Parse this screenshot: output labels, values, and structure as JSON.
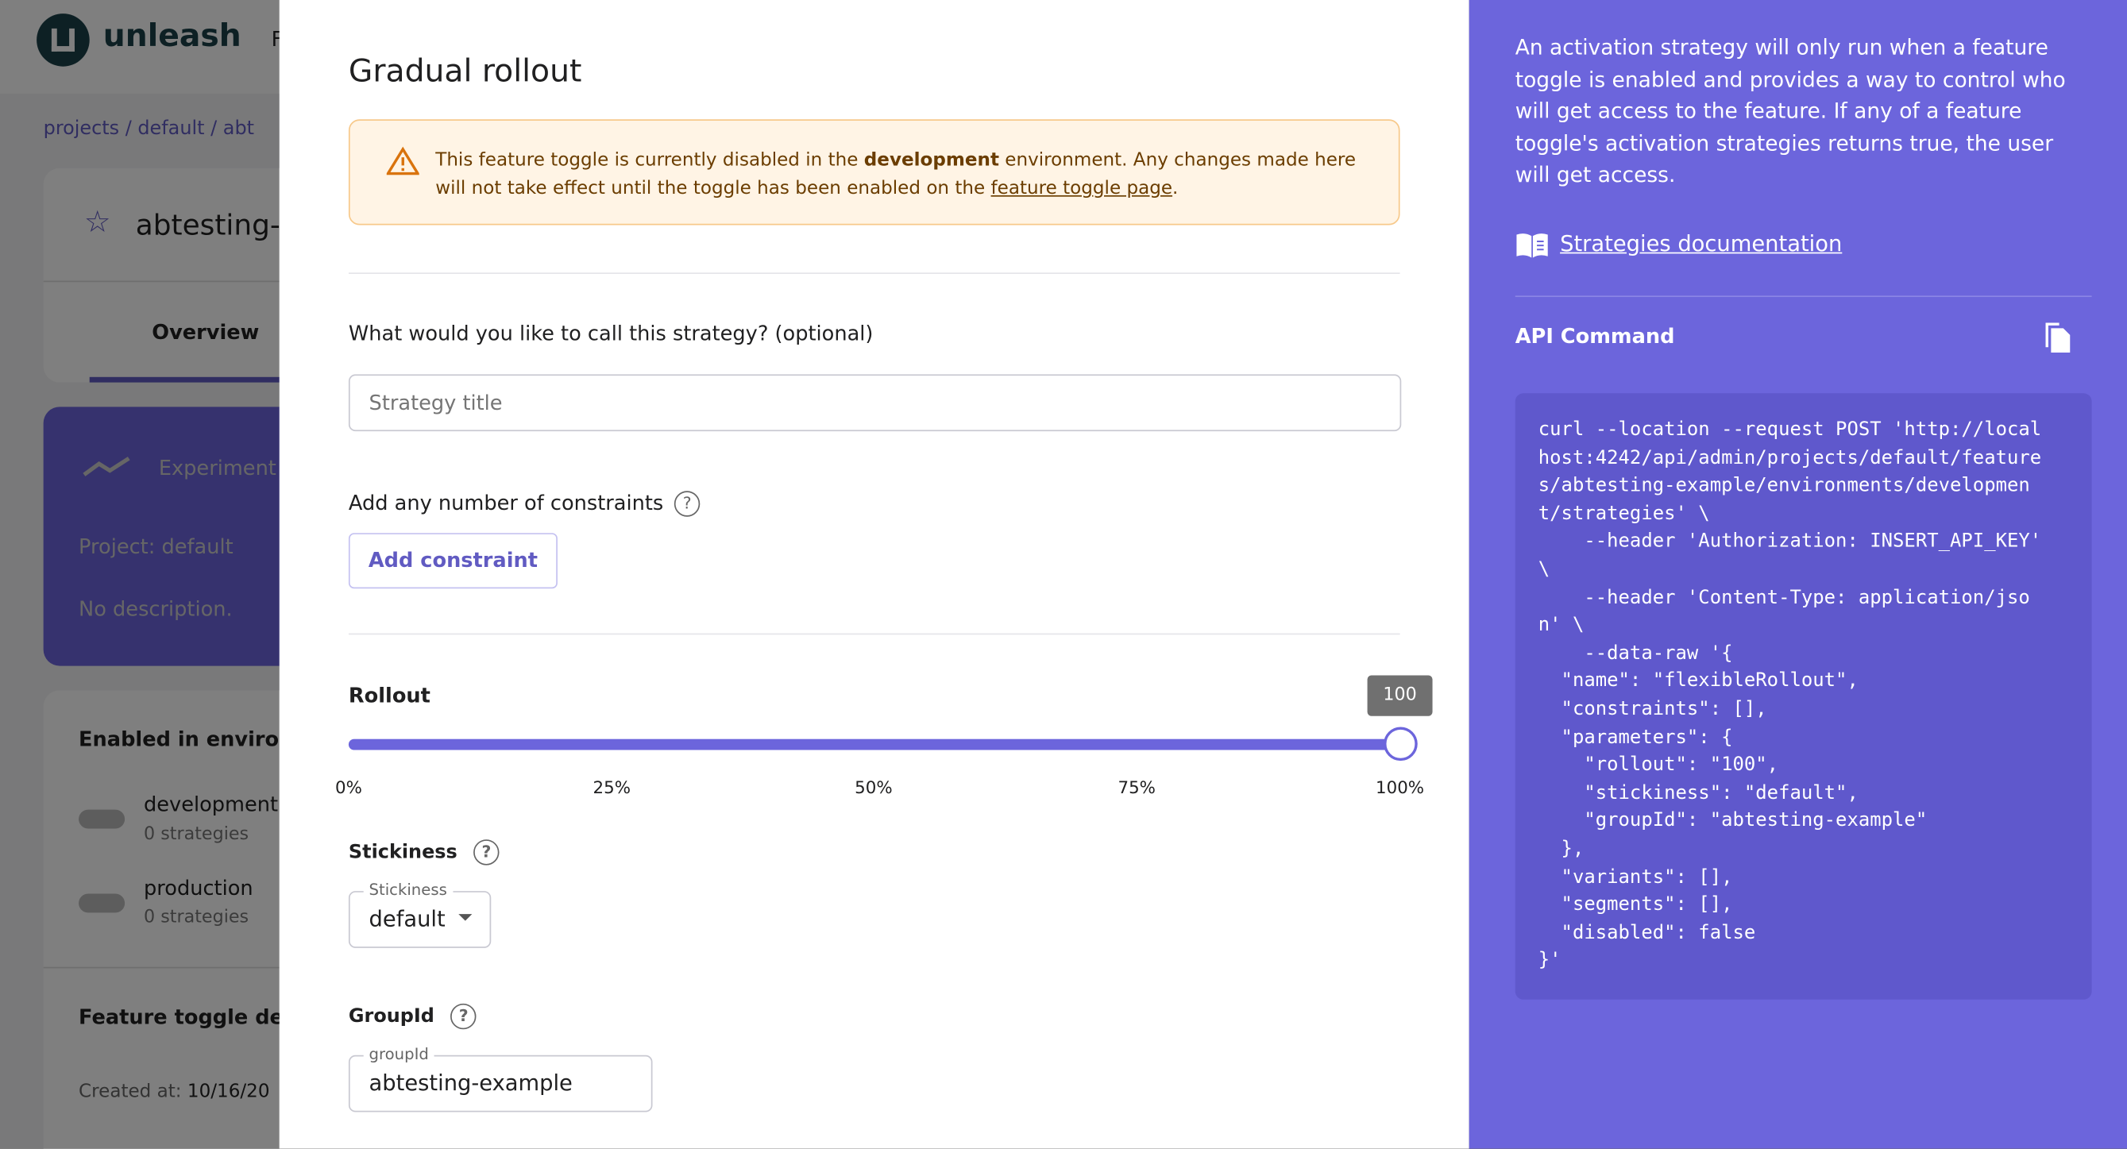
{
  "background": {
    "brand": "unleash",
    "nav_partial": "F",
    "breadcrumb": [
      "projects",
      "default",
      "abt"
    ],
    "feature_name": "abtesting-",
    "tab_overview": "Overview",
    "type_label": "Experiment",
    "project": "Project: default",
    "description": "No description.",
    "enabled_title": "Enabled in enviror",
    "environments": [
      {
        "name": "development",
        "strategies": "0 strategies"
      },
      {
        "name": "production",
        "strategies": "0 strategies"
      }
    ],
    "details_title": "Feature toggle de",
    "created_label": "Created at:",
    "created_value": "10/16/20"
  },
  "modal": {
    "title": "Gradual rollout",
    "alert": {
      "pre": "This feature toggle is currently disabled in the ",
      "env": "development",
      "mid": " environment. Any changes made here will not take effect until the toggle has been enabled on the ",
      "link": "feature toggle page",
      "post": "."
    },
    "name_question": "What would you like to call this strategy? (optional)",
    "title_placeholder": "Strategy title",
    "constraints_label": "Add any number of constraints",
    "add_constraint": "Add constraint",
    "rollout_label": "Rollout",
    "rollout_value": 100,
    "rollout_tooltip": "100",
    "ticks": [
      "0%",
      "25%",
      "50%",
      "75%",
      "100%"
    ],
    "stickiness_label": "Stickiness",
    "stickiness_field_label": "Stickiness",
    "stickiness_value": "default",
    "groupid_label": "GroupId",
    "groupid_field_label": "groupId",
    "groupid_value": "abtesting-example"
  },
  "sidebar": {
    "description": "An activation strategy will only run when a feature toggle is enabled and provides a way to control who will get access to the feature. If any of a feature toggle's activation strategies returns true, the user will get access.",
    "docs_link": "Strategies documentation",
    "api_title": "API Command",
    "code_lines": [
      "curl --location --request POST 'http://local",
      "host:4242/api/admin/projects/default/feature",
      "s/abtesting-example/environments/developmen",
      "t/strategies' \\",
      "    --header 'Authorization: INSERT_API_KEY'",
      "\\",
      "    --header 'Content-Type: application/jso",
      "n' \\",
      "    --data-raw '{",
      "  \"name\": \"flexibleRollout\",",
      "  \"constraints\": [],",
      "  \"parameters\": {",
      "    \"rollout\": \"100\",",
      "    \"stickiness\": \"default\",",
      "    \"groupId\": \"abtesting-example\"",
      "  },",
      "  \"variants\": [],",
      "  \"segments\": [],",
      "  \"disabled\": false",
      "}'"
    ]
  },
  "colors": {
    "primary": "#6c65dc",
    "sidebar": "#6c65dc",
    "code_bg": "#5f58cc",
    "alert_bg": "#fff4e5",
    "alert_icon": "#d9730d"
  }
}
